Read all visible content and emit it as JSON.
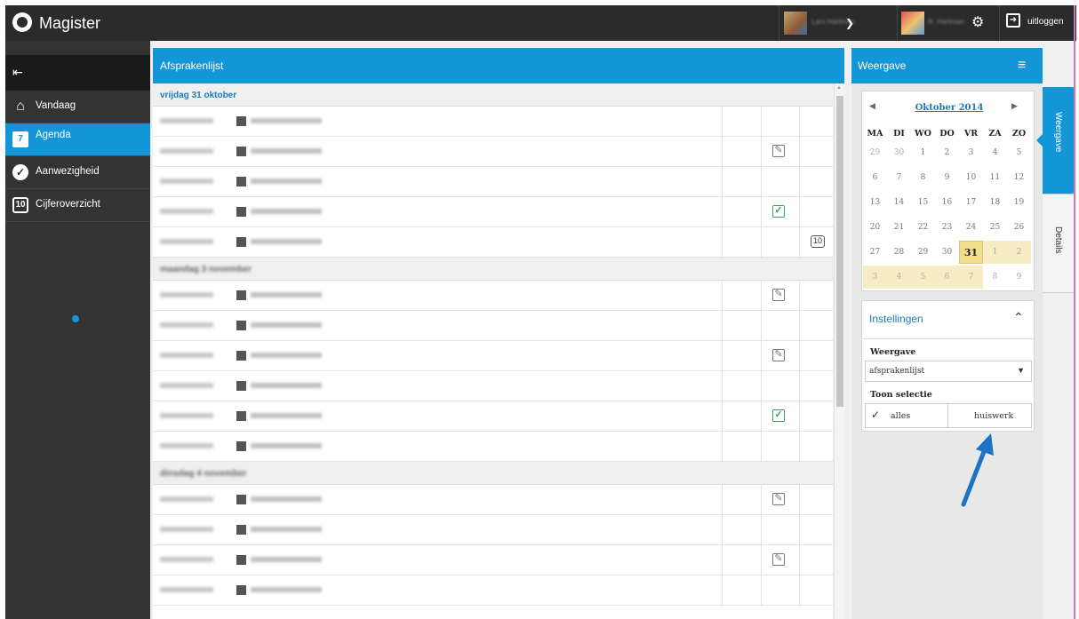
{
  "app": {
    "title": "Magister"
  },
  "topbar": {
    "user1_name": "Lars Hartman",
    "user2_name": "R. Hartman",
    "logout_label": "uitloggen"
  },
  "sidebar": {
    "items": [
      {
        "label": "Vandaag",
        "icon": "home-icon"
      },
      {
        "label": "Agenda",
        "icon": "calendar-icon"
      },
      {
        "label": "Aanwezigheid",
        "icon": "check-circle-icon"
      },
      {
        "label": "Cijferoverzicht",
        "icon": "grade-10-icon"
      }
    ],
    "active": "Agenda"
  },
  "main": {
    "title": "Afsprakenlijst",
    "days": [
      {
        "label": "vrijdag 31 oktober",
        "appointments": [
          {
            "time": "08:25 - 09:15",
            "desc": "3c - mkz - 4HZA (A215)",
            "status": ""
          },
          {
            "time": "09:15 - 10:05",
            "desc": "ak - cuu - 4HZA (A05)",
            "status": "homework"
          },
          {
            "time": "10:20 - 10:35",
            "desc": "ak - cuu - 4HZA (A05)",
            "status": ""
          },
          {
            "time": "11:10 - 12:00",
            "desc": "gs - ntk - 4HZA (A80)",
            "status": "done"
          },
          {
            "time": "12:00 - 12:50",
            "desc": "ne - lhar - 4HZA (A19)",
            "status": "test"
          }
        ]
      },
      {
        "label": "maandag 3 november",
        "appointments": [
          {
            "time": "08:25 - 09:15",
            "desc": "ec - aaf - 4HZA (A80)",
            "status": "homework"
          },
          {
            "time": "09:15 - 10:05",
            "desc": "bi - dje - 4HZA (A111)",
            "status": ""
          },
          {
            "time": "10:20 - 10:35",
            "desc": "gs - ssn - 4HZA (A09)",
            "status": "homework"
          },
          {
            "time": "11:10 - 12:00",
            "desc": "en - jde - 4HZA (A414)",
            "status": ""
          },
          {
            "time": "12:00 - 12:50",
            "desc": "ne - vrhe - 4HZA (A15)",
            "status": "done"
          },
          {
            "time": "13:10 - 14:00",
            "desc": "ac - jbs - 4HZA (A82)",
            "status": ""
          }
        ]
      },
      {
        "label": "dinsdag 4 november",
        "appointments": [
          {
            "time": "08:25 - 09:15",
            "desc": "ak - jjk - 4HZA (A80)",
            "status": "homework"
          },
          {
            "time": "09:15 - 10:05",
            "desc": "mu - fkn - 4HZA (A42)",
            "status": ""
          },
          {
            "time": "10:20 - 10:35",
            "desc": "fa - lhar - 4HZA (A414)",
            "status": "homework"
          },
          {
            "time": "11:10 - 12:00",
            "desc": "en - jde - 4HZA (A414)",
            "status": ""
          }
        ]
      }
    ]
  },
  "weergave_panel": {
    "title": "Weergave",
    "calendar": {
      "month_label": "Oktober 2014",
      "weekdays": [
        "MA",
        "DI",
        "WO",
        "DO",
        "VR",
        "ZA",
        "ZO"
      ],
      "weeks": [
        [
          "29",
          "30",
          "1",
          "2",
          "3",
          "4",
          "5"
        ],
        [
          "6",
          "7",
          "8",
          "9",
          "10",
          "11",
          "12"
        ],
        [
          "13",
          "14",
          "15",
          "16",
          "17",
          "18",
          "19"
        ],
        [
          "20",
          "21",
          "22",
          "23",
          "24",
          "25",
          "26"
        ],
        [
          "27",
          "28",
          "29",
          "30",
          "31",
          "1",
          "2"
        ],
        [
          "3",
          "4",
          "5",
          "6",
          "7",
          "8",
          "9"
        ]
      ],
      "selected_day": "31"
    },
    "side_tabs": [
      "Weergave",
      "Details"
    ],
    "settings": {
      "title": "Instellingen",
      "weergave_label": "Weergave",
      "weergave_value": "afsprakenlijst",
      "toon_selectie_label": "Toon selectie",
      "option_all": "alles",
      "option_homework": "huiswerk"
    }
  },
  "colors": {
    "accent": "#1296d8",
    "topbar": "#2b2b2b",
    "sidebar": "#333333",
    "arrow": "#1a73c4"
  }
}
